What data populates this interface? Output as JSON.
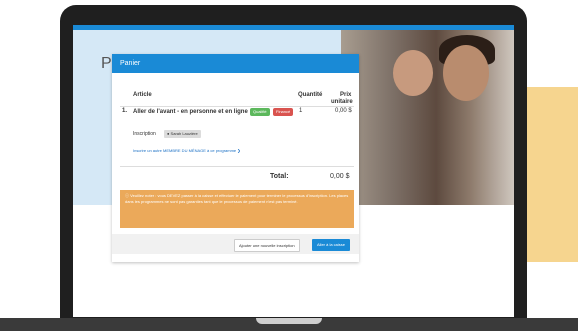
{
  "page": {
    "title": "Panier"
  },
  "panel": {
    "title": "Panier",
    "columns": {
      "article": "Article",
      "quantity": "Quantité",
      "price_line1": "Prix",
      "price_line2": "unitaire"
    },
    "item": {
      "number": "1.",
      "name": "Aller de l'avant - en personne et en ligne",
      "badge_green": "Qualifié",
      "badge_red": "Financé",
      "quantity": "1",
      "price": "0,00 $"
    },
    "inscription_label": "Inscription",
    "inscription_person": "Sarah Lauzière",
    "inscription_link": "Inscrire un autre MEMBRE DU MÉNAGE à ce programme",
    "total_label": "Total:",
    "total_value": "0,00 $",
    "notice": "Veuillez noter : vous DEVEZ passer à la caisse et effectuer le paiement pour terminer le processus d'inscription. Les places dans les programmes ne sont pas garanties tant que le processus de paiement n'est pas terminé.",
    "add_button": "Ajouter une nouvelle inscription",
    "checkout_button": "Aller à la caisse"
  },
  "colors": {
    "primary": "#1a8ad6",
    "notice": "#eba95a",
    "accent": "#f6d58f"
  }
}
